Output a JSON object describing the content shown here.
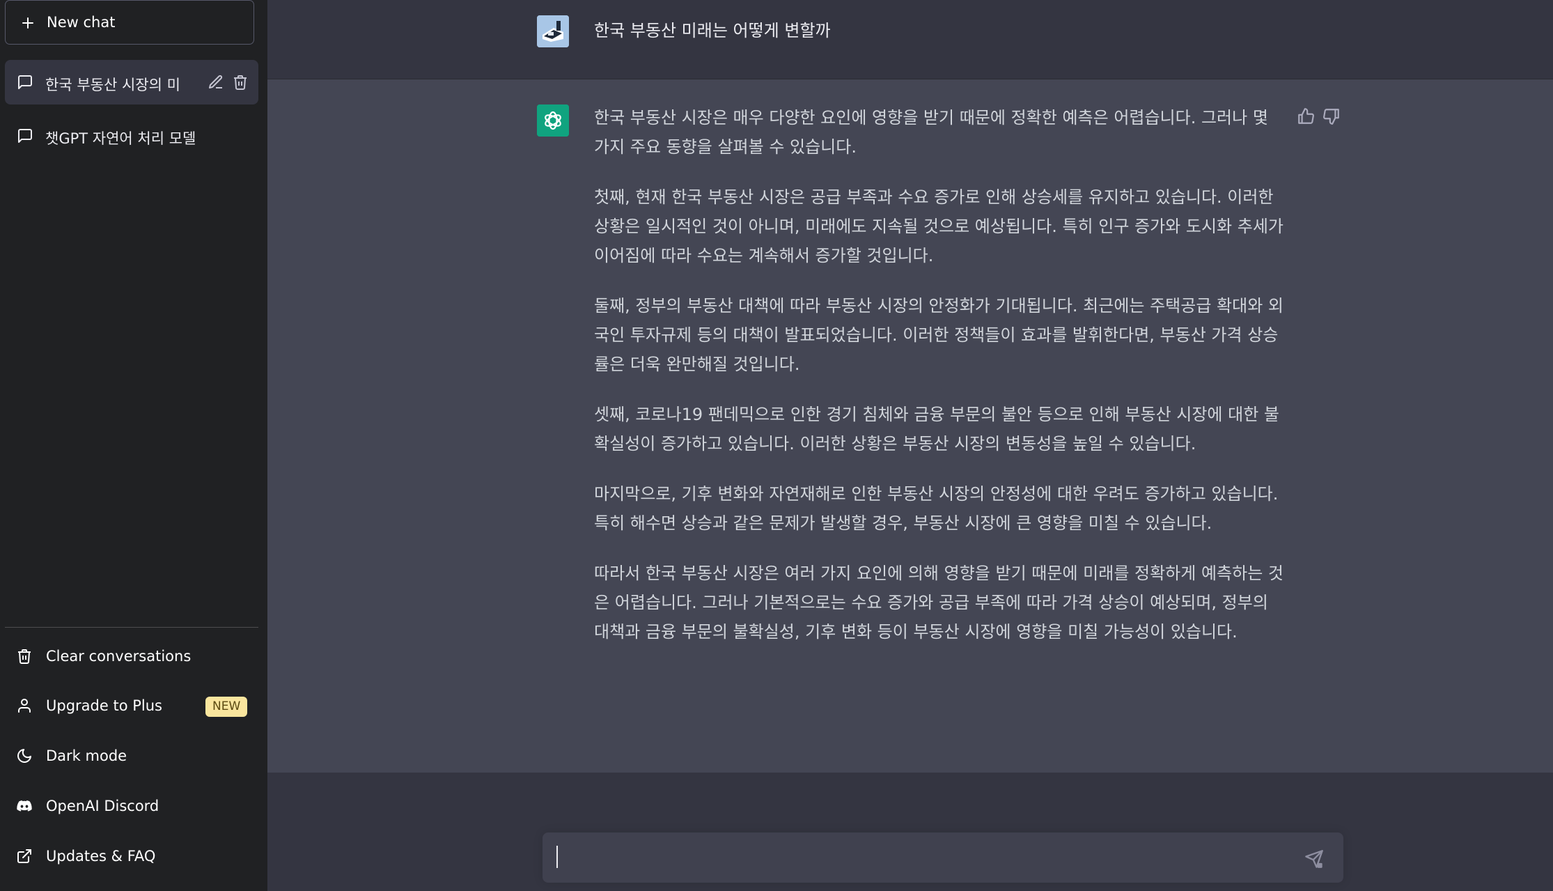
{
  "sidebar": {
    "new_chat_label": "New chat",
    "conversations": [
      {
        "title": "한국 부동산 시장의 미"
      },
      {
        "title": "챗GPT 자연어 처리 모델"
      }
    ],
    "menu": [
      {
        "label": "Clear conversations",
        "icon": "trash-icon"
      },
      {
        "label": "Upgrade to Plus",
        "icon": "user-icon",
        "badge": "NEW"
      },
      {
        "label": "Dark mode",
        "icon": "moon-icon"
      },
      {
        "label": "OpenAI Discord",
        "icon": "discord-icon"
      },
      {
        "label": "Updates & FAQ",
        "icon": "external-link-icon"
      }
    ]
  },
  "thread": {
    "user_message": "한국 부동산 미래는 어떻게 변할까",
    "assistant_paragraphs": [
      "한국 부동산 시장은 매우 다양한 요인에 영향을 받기 때문에 정확한 예측은 어렵습니다. 그러나 몇 가지 주요 동향을 살펴볼 수 있습니다.",
      "첫째, 현재 한국 부동산 시장은 공급 부족과 수요 증가로 인해 상승세를 유지하고 있습니다. 이러한 상황은 일시적인 것이 아니며, 미래에도 지속될 것으로 예상됩니다. 특히 인구 증가와 도시화 추세가 이어짐에 따라 수요는 계속해서 증가할 것입니다.",
      "둘째, 정부의 부동산 대책에 따라 부동산 시장의 안정화가 기대됩니다. 최근에는 주택공급 확대와 외국인 투자규제 등의 대책이 발표되었습니다. 이러한 정책들이 효과를 발휘한다면, 부동산 가격 상승률은 더욱 완만해질 것입니다.",
      "셋째, 코로나19 팬데믹으로 인한 경기 침체와 금융 부문의 불안 등으로 인해 부동산 시장에 대한 불확실성이 증가하고 있습니다. 이러한 상황은 부동산 시장의 변동성을 높일 수 있습니다.",
      "마지막으로, 기후 변화와 자연재해로 인한 부동산 시장의 안정성에 대한 우려도 증가하고 있습니다. 특히 해수면 상승과 같은 문제가 발생할 경우, 부동산 시장에 큰 영향을 미칠 수 있습니다.",
      "따라서 한국 부동산 시장은 여러 가지 요인에 의해 영향을 받기 때문에 미래를 정확하게 예측하는 것은 어렵습니다. 그러나 기본적으로는 수요 증가와 공급 부족에 따라 가격 상승이 예상되며, 정부의 대책과 금융 부문의 불확실성, 기후 변화 등이 부동산 시장에 영향을 미칠 가능성이 있습니다."
    ]
  },
  "composer": {
    "value": ""
  },
  "colors": {
    "sidebar_bg": "#202123",
    "main_bg": "#343541",
    "assistant_bg": "#444654",
    "openai_green": "#10a37f",
    "badge_bg": "#fae69e"
  }
}
